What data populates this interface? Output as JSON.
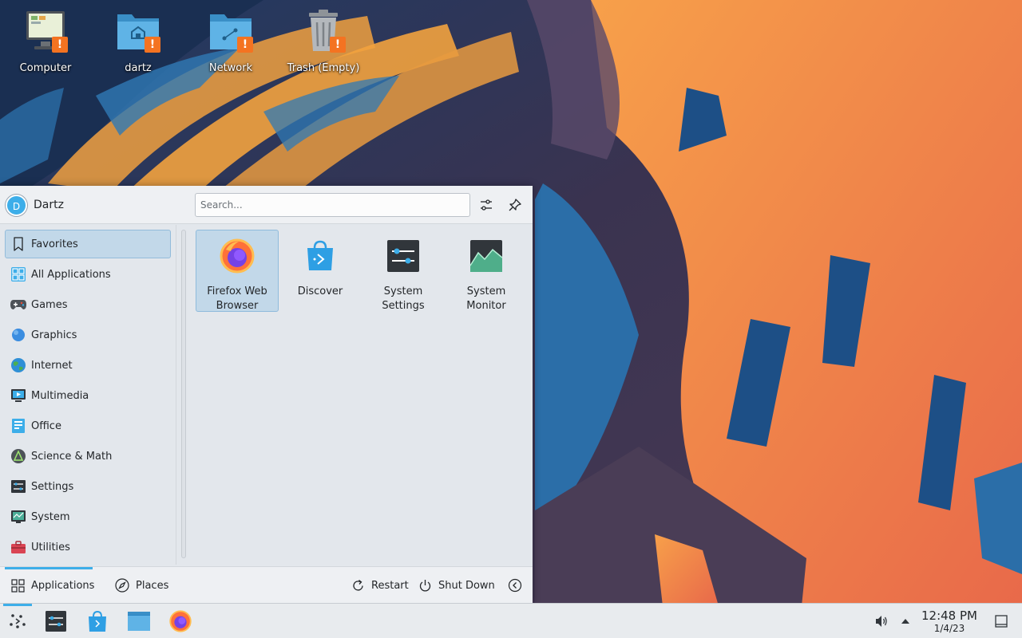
{
  "desktop": {
    "icons": [
      {
        "label": "Computer",
        "icon": "computer-icon"
      },
      {
        "label": "dartz",
        "icon": "home-folder-icon"
      },
      {
        "label": "Network",
        "icon": "network-folder-icon"
      },
      {
        "label": "Trash (Empty)",
        "icon": "trash-icon"
      }
    ],
    "warning_badge": "!"
  },
  "launcher": {
    "user": {
      "name": "Dartz",
      "initial": "D"
    },
    "search": {
      "placeholder": "Search...",
      "value": ""
    },
    "categories": [
      {
        "label": "Favorites",
        "icon": "bookmark-icon",
        "active": true
      },
      {
        "label": "All Applications",
        "icon": "grid-apps-icon"
      },
      {
        "label": "Games",
        "icon": "gamepad-icon"
      },
      {
        "label": "Graphics",
        "icon": "graphics-icon"
      },
      {
        "label": "Internet",
        "icon": "globe-icon"
      },
      {
        "label": "Multimedia",
        "icon": "multimedia-icon"
      },
      {
        "label": "Office",
        "icon": "office-icon"
      },
      {
        "label": "Science & Math",
        "icon": "science-icon"
      },
      {
        "label": "Settings",
        "icon": "settings-icon"
      },
      {
        "label": "System",
        "icon": "system-icon"
      },
      {
        "label": "Utilities",
        "icon": "toolbox-icon"
      }
    ],
    "favorites": [
      {
        "label": "Firefox Web Browser",
        "line1": "Firefox Web",
        "line2": "Browser",
        "icon": "firefox-icon",
        "selected": true
      },
      {
        "label": "Discover",
        "line1": "Discover",
        "line2": "",
        "icon": "discover-icon"
      },
      {
        "label": "System Settings",
        "line1": "System",
        "line2": "Settings",
        "icon": "system-settings-icon"
      },
      {
        "label": "System Monitor",
        "line1": "System",
        "line2": "Monitor",
        "icon": "system-monitor-icon"
      }
    ],
    "footer": {
      "applications_tab": "Applications",
      "places_tab": "Places",
      "restart": "Restart",
      "shutdown": "Shut Down"
    }
  },
  "panel": {
    "clock_time": "12:48 PM",
    "clock_date": "1/4/23",
    "colors": {
      "accent": "#3daee9",
      "warning": "#f47321"
    }
  }
}
